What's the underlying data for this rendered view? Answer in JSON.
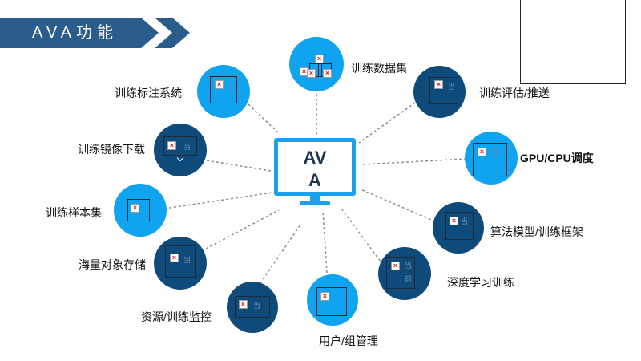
{
  "title": "AVA功能",
  "center": {
    "line1": "AV",
    "line2": "A"
  },
  "nodes": [
    {
      "id": "dataset",
      "label": "训练数据集"
    },
    {
      "id": "eval_push",
      "label": "训练评估/推送"
    },
    {
      "id": "gpu_cpu",
      "label": "GPU/CPU调度"
    },
    {
      "id": "algo_framework",
      "label": "算法模型/训练框架"
    },
    {
      "id": "deep_learning",
      "label": "深度学习训练"
    },
    {
      "id": "user_group",
      "label": "用户/组管理"
    },
    {
      "id": "resource_monitor",
      "label": "资源/训练监控"
    },
    {
      "id": "storage",
      "label": "海量对象存储"
    },
    {
      "id": "sample_set",
      "label": "训练样本集"
    },
    {
      "id": "image_download",
      "label": "训练镜像下载"
    },
    {
      "id": "labeling",
      "label": "训练标注系统"
    }
  ],
  "placeholder_glyphs": {
    "dang": "当",
    "qian": "前"
  },
  "colors": {
    "light_node": "#10a3ef",
    "dark_node": "#0e4a7a",
    "banner": "#2a5d8c",
    "monitor": "#1aa1ee"
  }
}
